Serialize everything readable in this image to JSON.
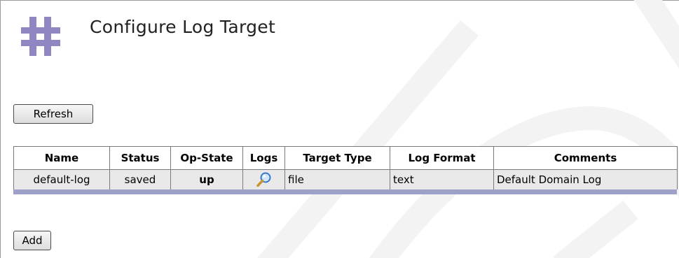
{
  "page": {
    "title": "Configure Log Target"
  },
  "toolbar": {
    "refresh_label": "Refresh",
    "add_label": "Add"
  },
  "table": {
    "headers": [
      "Name",
      "Status",
      "Op-State",
      "Logs",
      "Target Type",
      "Log Format",
      "Comments"
    ],
    "rows": [
      {
        "name": "default-log",
        "status": "saved",
        "op_state": "up",
        "logs_icon": "magnifier-icon",
        "target_type": "file",
        "log_format": "text",
        "comments": "Default Domain Log"
      }
    ]
  },
  "icons": {
    "header_icon": "log-target-icon",
    "header_icon_color": "#8f86c2"
  },
  "colors": {
    "row_background": "#e9e9e9",
    "table_underline": "#9da0c8"
  }
}
